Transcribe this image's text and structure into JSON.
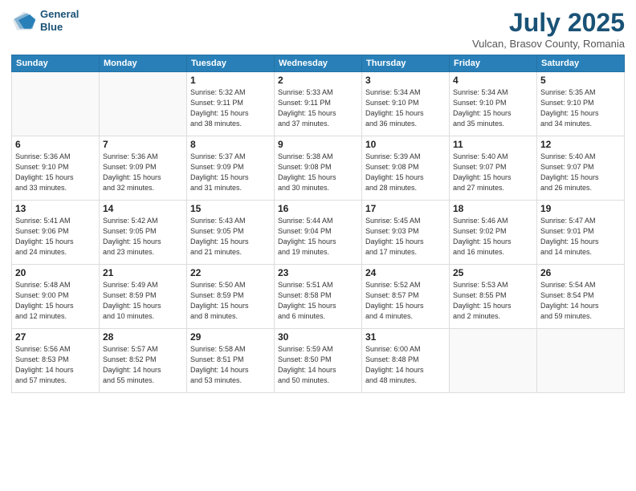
{
  "header": {
    "logo_line1": "General",
    "logo_line2": "Blue",
    "month": "July 2025",
    "location": "Vulcan, Brasov County, Romania"
  },
  "weekdays": [
    "Sunday",
    "Monday",
    "Tuesday",
    "Wednesday",
    "Thursday",
    "Friday",
    "Saturday"
  ],
  "weeks": [
    [
      {
        "day": "",
        "info": ""
      },
      {
        "day": "",
        "info": ""
      },
      {
        "day": "1",
        "info": "Sunrise: 5:32 AM\nSunset: 9:11 PM\nDaylight: 15 hours\nand 38 minutes."
      },
      {
        "day": "2",
        "info": "Sunrise: 5:33 AM\nSunset: 9:11 PM\nDaylight: 15 hours\nand 37 minutes."
      },
      {
        "day": "3",
        "info": "Sunrise: 5:34 AM\nSunset: 9:10 PM\nDaylight: 15 hours\nand 36 minutes."
      },
      {
        "day": "4",
        "info": "Sunrise: 5:34 AM\nSunset: 9:10 PM\nDaylight: 15 hours\nand 35 minutes."
      },
      {
        "day": "5",
        "info": "Sunrise: 5:35 AM\nSunset: 9:10 PM\nDaylight: 15 hours\nand 34 minutes."
      }
    ],
    [
      {
        "day": "6",
        "info": "Sunrise: 5:36 AM\nSunset: 9:10 PM\nDaylight: 15 hours\nand 33 minutes."
      },
      {
        "day": "7",
        "info": "Sunrise: 5:36 AM\nSunset: 9:09 PM\nDaylight: 15 hours\nand 32 minutes."
      },
      {
        "day": "8",
        "info": "Sunrise: 5:37 AM\nSunset: 9:09 PM\nDaylight: 15 hours\nand 31 minutes."
      },
      {
        "day": "9",
        "info": "Sunrise: 5:38 AM\nSunset: 9:08 PM\nDaylight: 15 hours\nand 30 minutes."
      },
      {
        "day": "10",
        "info": "Sunrise: 5:39 AM\nSunset: 9:08 PM\nDaylight: 15 hours\nand 28 minutes."
      },
      {
        "day": "11",
        "info": "Sunrise: 5:40 AM\nSunset: 9:07 PM\nDaylight: 15 hours\nand 27 minutes."
      },
      {
        "day": "12",
        "info": "Sunrise: 5:40 AM\nSunset: 9:07 PM\nDaylight: 15 hours\nand 26 minutes."
      }
    ],
    [
      {
        "day": "13",
        "info": "Sunrise: 5:41 AM\nSunset: 9:06 PM\nDaylight: 15 hours\nand 24 minutes."
      },
      {
        "day": "14",
        "info": "Sunrise: 5:42 AM\nSunset: 9:05 PM\nDaylight: 15 hours\nand 23 minutes."
      },
      {
        "day": "15",
        "info": "Sunrise: 5:43 AM\nSunset: 9:05 PM\nDaylight: 15 hours\nand 21 minutes."
      },
      {
        "day": "16",
        "info": "Sunrise: 5:44 AM\nSunset: 9:04 PM\nDaylight: 15 hours\nand 19 minutes."
      },
      {
        "day": "17",
        "info": "Sunrise: 5:45 AM\nSunset: 9:03 PM\nDaylight: 15 hours\nand 17 minutes."
      },
      {
        "day": "18",
        "info": "Sunrise: 5:46 AM\nSunset: 9:02 PM\nDaylight: 15 hours\nand 16 minutes."
      },
      {
        "day": "19",
        "info": "Sunrise: 5:47 AM\nSunset: 9:01 PM\nDaylight: 15 hours\nand 14 minutes."
      }
    ],
    [
      {
        "day": "20",
        "info": "Sunrise: 5:48 AM\nSunset: 9:00 PM\nDaylight: 15 hours\nand 12 minutes."
      },
      {
        "day": "21",
        "info": "Sunrise: 5:49 AM\nSunset: 8:59 PM\nDaylight: 15 hours\nand 10 minutes."
      },
      {
        "day": "22",
        "info": "Sunrise: 5:50 AM\nSunset: 8:59 PM\nDaylight: 15 hours\nand 8 minutes."
      },
      {
        "day": "23",
        "info": "Sunrise: 5:51 AM\nSunset: 8:58 PM\nDaylight: 15 hours\nand 6 minutes."
      },
      {
        "day": "24",
        "info": "Sunrise: 5:52 AM\nSunset: 8:57 PM\nDaylight: 15 hours\nand 4 minutes."
      },
      {
        "day": "25",
        "info": "Sunrise: 5:53 AM\nSunset: 8:55 PM\nDaylight: 15 hours\nand 2 minutes."
      },
      {
        "day": "26",
        "info": "Sunrise: 5:54 AM\nSunset: 8:54 PM\nDaylight: 14 hours\nand 59 minutes."
      }
    ],
    [
      {
        "day": "27",
        "info": "Sunrise: 5:56 AM\nSunset: 8:53 PM\nDaylight: 14 hours\nand 57 minutes."
      },
      {
        "day": "28",
        "info": "Sunrise: 5:57 AM\nSunset: 8:52 PM\nDaylight: 14 hours\nand 55 minutes."
      },
      {
        "day": "29",
        "info": "Sunrise: 5:58 AM\nSunset: 8:51 PM\nDaylight: 14 hours\nand 53 minutes."
      },
      {
        "day": "30",
        "info": "Sunrise: 5:59 AM\nSunset: 8:50 PM\nDaylight: 14 hours\nand 50 minutes."
      },
      {
        "day": "31",
        "info": "Sunrise: 6:00 AM\nSunset: 8:48 PM\nDaylight: 14 hours\nand 48 minutes."
      },
      {
        "day": "",
        "info": ""
      },
      {
        "day": "",
        "info": ""
      }
    ]
  ]
}
